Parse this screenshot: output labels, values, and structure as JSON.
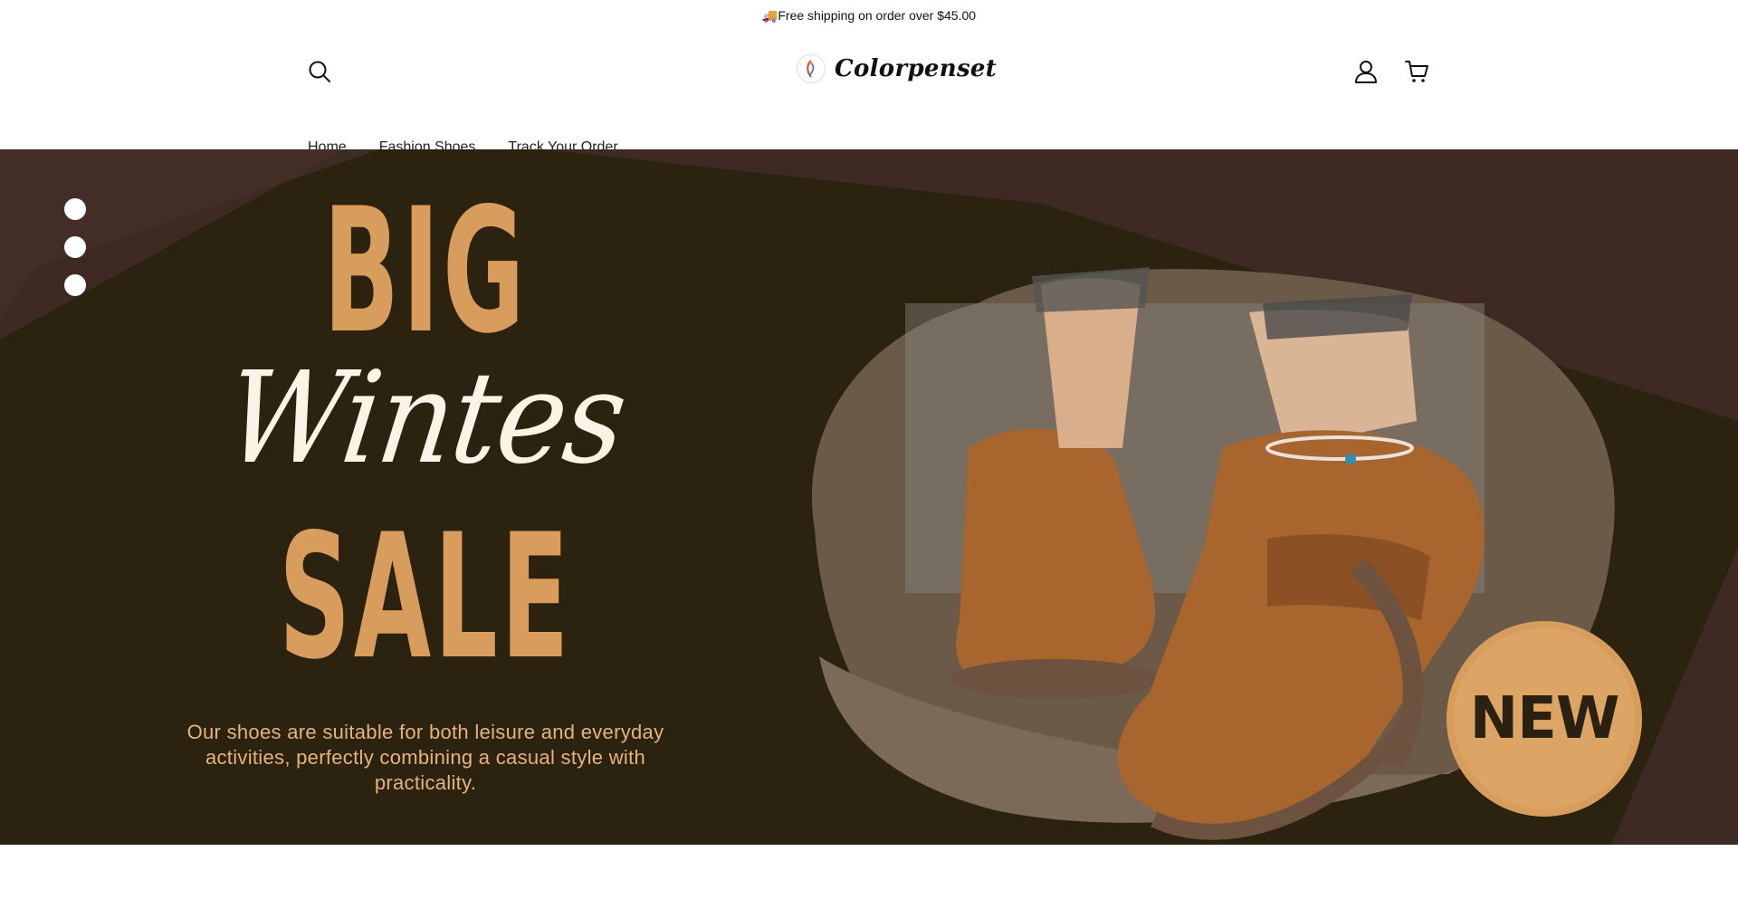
{
  "announcement": {
    "text": "🚚Free shipping on order over $45.00"
  },
  "header": {
    "logo_text": "Colorpenset",
    "icons": {
      "search": "search-icon",
      "account": "user-icon",
      "cart": "cart-icon"
    }
  },
  "nav": {
    "items": [
      {
        "label": "Home"
      },
      {
        "label": "Fashion Shoes"
      },
      {
        "label": "Track Your Order"
      }
    ]
  },
  "hero": {
    "slide_count": 3,
    "headline_big": "BIG",
    "headline_script": "Wintes",
    "headline_sale": "SALE",
    "description": "Our shoes are suitable for both leisure and everyday activities, perfectly combining a casual style with practicality.",
    "badge": "NEW",
    "colors": {
      "background_dark": "#2b2210",
      "background_brown": "#3e2a22",
      "accent_tan": "#d89d5c",
      "script_cream": "#fbf4e6",
      "suede": "#a8652e"
    }
  }
}
